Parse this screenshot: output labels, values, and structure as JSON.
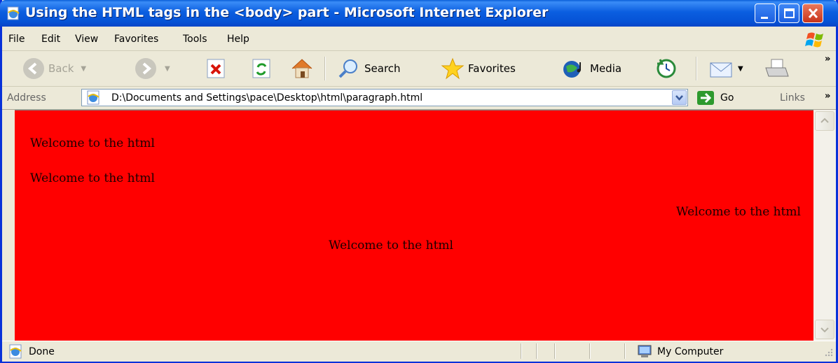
{
  "window": {
    "title": "Using the HTML tags in the <body> part - Microsoft Internet Explorer"
  },
  "menu": [
    "File",
    "Edit",
    "View",
    "Favorites",
    "Tools",
    "Help"
  ],
  "toolbar": {
    "back_label": "Back",
    "search_label": "Search",
    "favorites_label": "Favorites",
    "media_label": "Media"
  },
  "address": {
    "label": "Address",
    "url": "D:\\Documents and Settings\\pace\\Desktop\\html\\paragraph.html",
    "go_label": "Go",
    "links_label": "Links"
  },
  "content": {
    "background": "#ff0000",
    "paragraphs": [
      {
        "text": "Welcome to the html",
        "align": "left"
      },
      {
        "text": "Welcome to the html",
        "align": "left"
      },
      {
        "text": "Welcome to the html",
        "align": "right"
      },
      {
        "text": "Welcome to the html",
        "align": "center"
      }
    ]
  },
  "status": {
    "text": "Done",
    "zone": "My Computer"
  }
}
